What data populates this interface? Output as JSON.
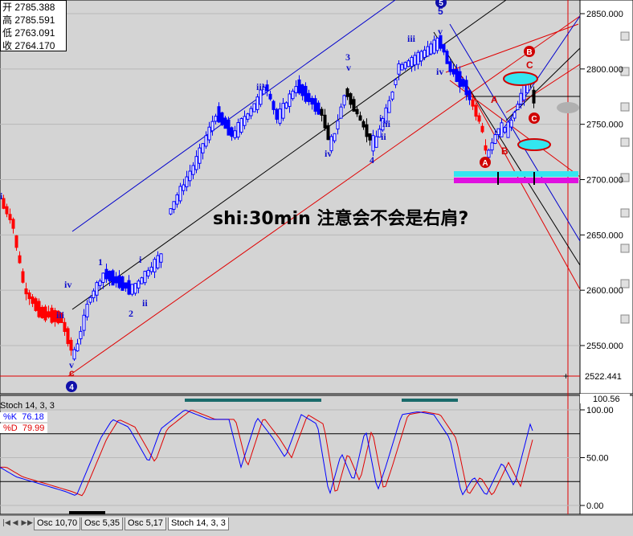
{
  "ohlc": {
    "open_label": "开",
    "open": "2785.388",
    "high_label": "高",
    "high": "2785.591",
    "low_label": "低",
    "low": "2763.091",
    "close_label": "收",
    "close": "2764.170"
  },
  "annotation": "shi:30min 注意会不会是右肩?",
  "price_axis": [
    "2850.000",
    "2800.000",
    "2750.000",
    "2700.000",
    "2650.000",
    "2600.000",
    "2550.000"
  ],
  "current_price": "2522.441",
  "stoch": {
    "title": "Stoch 14, 3, 3",
    "k_label": "%K",
    "k_value": "76.18",
    "d_label": "%D",
    "d_value": "79.99",
    "top_value": "100.56",
    "axis": [
      "100.00",
      "50.00",
      "0.00"
    ]
  },
  "tabs": [
    "Osc 10,70",
    "Osc 5,35",
    "Osc 5,17",
    "Stoch 14, 3, 3"
  ],
  "active_tab": "Stoch 14, 3, 3",
  "wave_labels": {
    "blue": [
      "i",
      "iv",
      "iii",
      "v",
      "1",
      "2",
      "i",
      "ii",
      "iii",
      "3",
      "iv",
      "4",
      "i",
      "ii",
      "iii",
      "5",
      "v",
      "iv",
      "iii"
    ],
    "red": [
      "c",
      "A",
      "B",
      "A",
      "B",
      "C",
      "C"
    ],
    "circled": [
      "4",
      "5",
      "A",
      "B",
      "C"
    ]
  },
  "colors": {
    "bull": "#0000ff",
    "bear": "#ff0000",
    "bg": "#d4d4d4",
    "cyan": "#33e6f0",
    "magenta": "#e010e0"
  },
  "chart_data": {
    "type": "candlestick",
    "title": "shi:30min",
    "ylim": [
      2510,
      2860
    ],
    "price_ticks": [
      2850,
      2800,
      2750,
      2700,
      2650,
      2600,
      2550
    ],
    "last": 2522.441,
    "indicator": {
      "name": "Stoch 14, 3, 3",
      "k": 76.18,
      "d": 79.99,
      "levels": [
        100,
        75,
        50,
        25,
        0
      ]
    }
  }
}
